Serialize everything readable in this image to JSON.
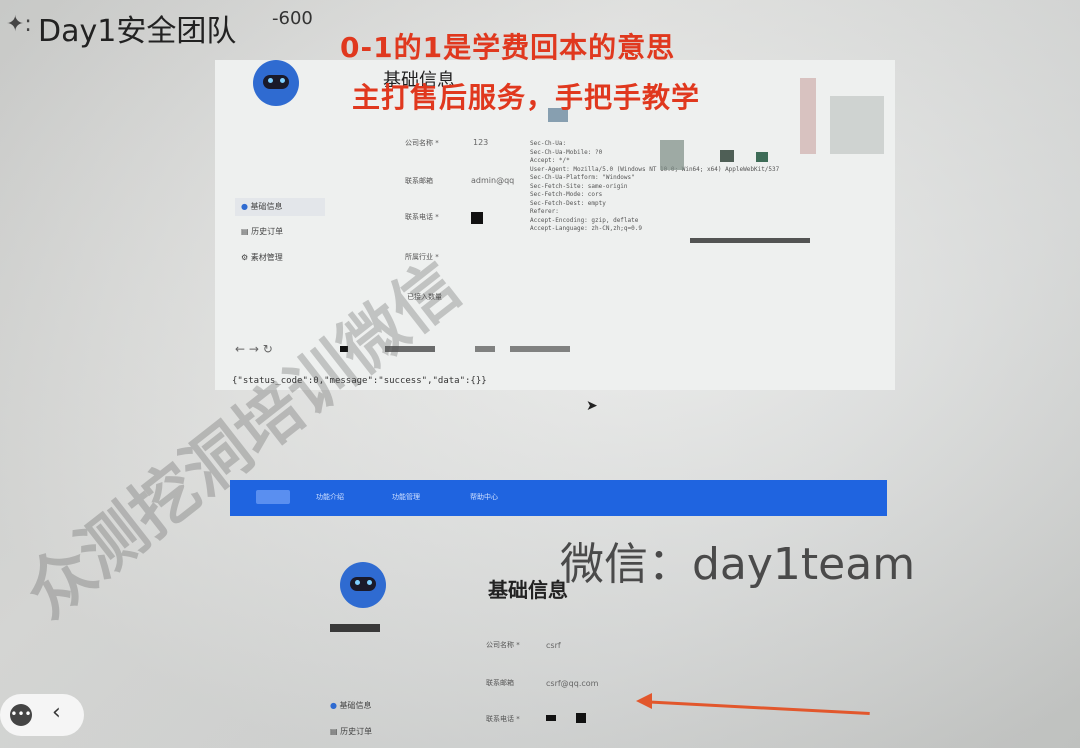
{
  "header": {
    "title": "Day1安全团队",
    "overlay_text": "-600",
    "prefix_glyph": "✦:"
  },
  "red_banner": {
    "line1": "0-1的1是学费回本的意思",
    "line2": "主打售后服务，手把手教学"
  },
  "top_screen": {
    "section_title": "基础信息",
    "sidebar": [
      {
        "label": "基础信息",
        "active": true
      },
      {
        "label": "历史订单",
        "active": false
      },
      {
        "label": "素材管理",
        "active": false
      }
    ],
    "fields": [
      {
        "label": "公司名称 *",
        "value": "123"
      },
      {
        "label": "联系邮箱",
        "value": "admin@qq"
      },
      {
        "label": "联系电话 *",
        "value": ""
      },
      {
        "label": "所属行业 *",
        "value": ""
      },
      {
        "label": "已接入数量",
        "value": ""
      }
    ],
    "http_headers": [
      "Sec-Ch-Ua:",
      "Sec-Ch-Ua-Mobile: ?0",
      "Accept: */*",
      "User-Agent: Mozilla/5.0 (Windows NT 10.0; Win64; x64) AppleWebKit/537",
      "Sec-Ch-Ua-Platform: \"Windows\"",
      "Sec-Fetch-Site: same-origin",
      "Sec-Fetch-Mode: cors",
      "Sec-Fetch-Dest: empty",
      "Referer:",
      "Accept-Encoding: gzip, deflate",
      "Accept-Language: zh-CN,zh;q=0.9"
    ],
    "json_response": "{\"status_code\":0,\"message\":\"success\",\"data\":{}}"
  },
  "bottom_screen": {
    "nav_items": [
      "功能介绍",
      "功能管理",
      "帮助中心"
    ],
    "section_title": "基础信息",
    "sidebar": [
      {
        "label": "基础信息"
      },
      {
        "label": "历史订单"
      }
    ],
    "fields": [
      {
        "label": "公司名称 *",
        "value": "csrf"
      },
      {
        "label": "联系邮箱",
        "value": "csrf@qq.com"
      },
      {
        "label": "联系电话 *",
        "value": ""
      }
    ]
  },
  "watermarks": {
    "diagonal": "众测挖洞培训微信",
    "wechat": "微信：day1team"
  },
  "colors": {
    "red": "#e0381e",
    "navbar_blue": "#1f64e0",
    "arrow": "#e2572c"
  }
}
